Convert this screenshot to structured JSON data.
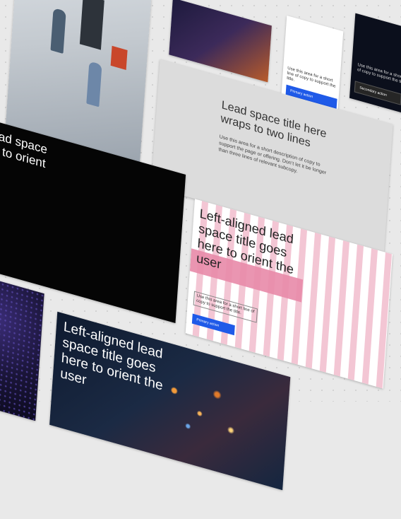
{
  "gray_card": {
    "title": "Lead space title here wraps to two lines",
    "description": "Use this area for a short description of copy to support the page or offering. Don’t let it be longer than three lines of relevant subcopy."
  },
  "black_card": {
    "title": "lead space\nre to orient"
  },
  "pink_card": {
    "title": "Left-aligned lead space title goes here to orient the user",
    "subtitle": "Use this area for a short line of copy to support the title.",
    "primary_action": "Primary action"
  },
  "dark_card": {
    "title": "Left-aligned lead space title goes here to orient the user"
  },
  "top_white_card": {
    "subtitle": "Use this area for a short line of copy to support the title.",
    "primary_action": "Primary action"
  },
  "top_dark_card": {
    "subtitle": "Use this area for a short line of copy to support the title.",
    "secondary_action": "Secondary action"
  },
  "colors": {
    "primary_button": "#1f5ae8",
    "pink_stripe": "#f3c6d4",
    "pink_band": "#e88aa9"
  }
}
